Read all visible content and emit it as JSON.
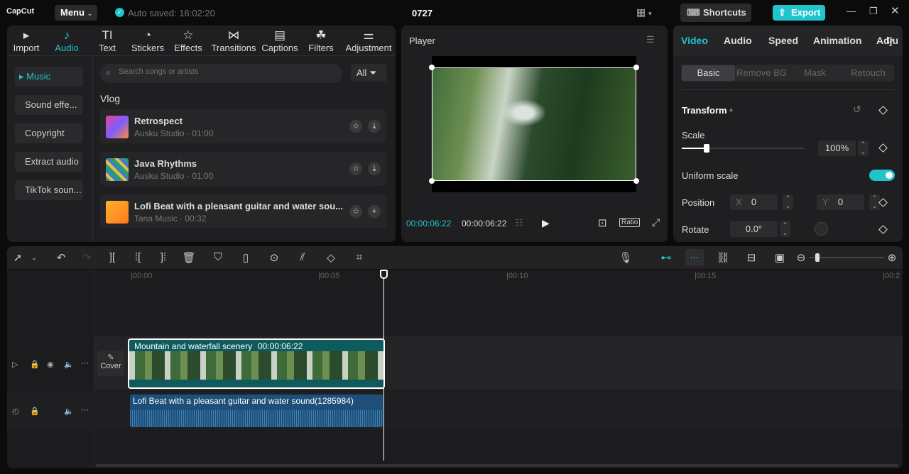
{
  "app": {
    "logo": "CapCut",
    "menu": "Menu",
    "autosave": "Auto saved: 16:02:20",
    "project": "0727",
    "shortcuts": "Shortcuts",
    "export": "Export"
  },
  "tabs": [
    {
      "label": "Import",
      "icon": "▸"
    },
    {
      "label": "Audio",
      "icon": "♪"
    },
    {
      "label": "Text",
      "icon": "TI"
    },
    {
      "label": "Stickers",
      "icon": "◔"
    },
    {
      "label": "Effects",
      "icon": "☆"
    },
    {
      "label": "Transitions",
      "icon": "⋈"
    },
    {
      "label": "Captions",
      "icon": "▤"
    },
    {
      "label": "Filters",
      "icon": "☘"
    },
    {
      "label": "Adjustment",
      "icon": "⚌"
    }
  ],
  "sidebar": [
    "Music",
    "Sound effe...",
    "Copyright",
    "Extract audio",
    "TikTok soun..."
  ],
  "search": {
    "placeholder": "Search songs or artists",
    "filter": "All"
  },
  "section": "Vlog",
  "tracks": [
    {
      "title": "Retrospect",
      "sub": "Ausku Studio · 01:00"
    },
    {
      "title": "Java Rhythms",
      "sub": "Ausku Studio · 01:00"
    },
    {
      "title": "Lofi Beat with a pleasant guitar and water sou...",
      "sub": "Tana Music · 00:32"
    }
  ],
  "player": {
    "title": "Player",
    "current": "00:00:06:22",
    "total": "00:00:06:22",
    "ratio": "Ratio"
  },
  "right": {
    "tabs": [
      "Video",
      "Audio",
      "Speed",
      "Animation",
      "Adjust"
    ],
    "subtabs": [
      "Basic",
      "Remove BG",
      "Mask",
      "Retouch"
    ],
    "transform": "Transform",
    "scale_label": "Scale",
    "scale": "100%",
    "scale_fraction": 0.2,
    "uniform": "Uniform scale",
    "uniform_on": true,
    "position": "Position",
    "x_label": "X",
    "x": "0",
    "y_label": "Y",
    "y": "0",
    "rotate": "Rotate",
    "rotate_val": "0.0°"
  },
  "timeline": {
    "ticks": [
      "00:00",
      "00:05",
      "00:10",
      "00:15",
      "00:2"
    ],
    "cover": "Cover",
    "video_clip": {
      "name": "Mountain and waterfall scenery",
      "duration": "00:00:06:22"
    },
    "audio_clip": "Lofi Beat with a pleasant guitar and water sound(1285984)"
  },
  "colors": {
    "accent": "#20c4cc",
    "video_clip": "#0f5a5c",
    "audio_clip": "#1d4f7a"
  }
}
